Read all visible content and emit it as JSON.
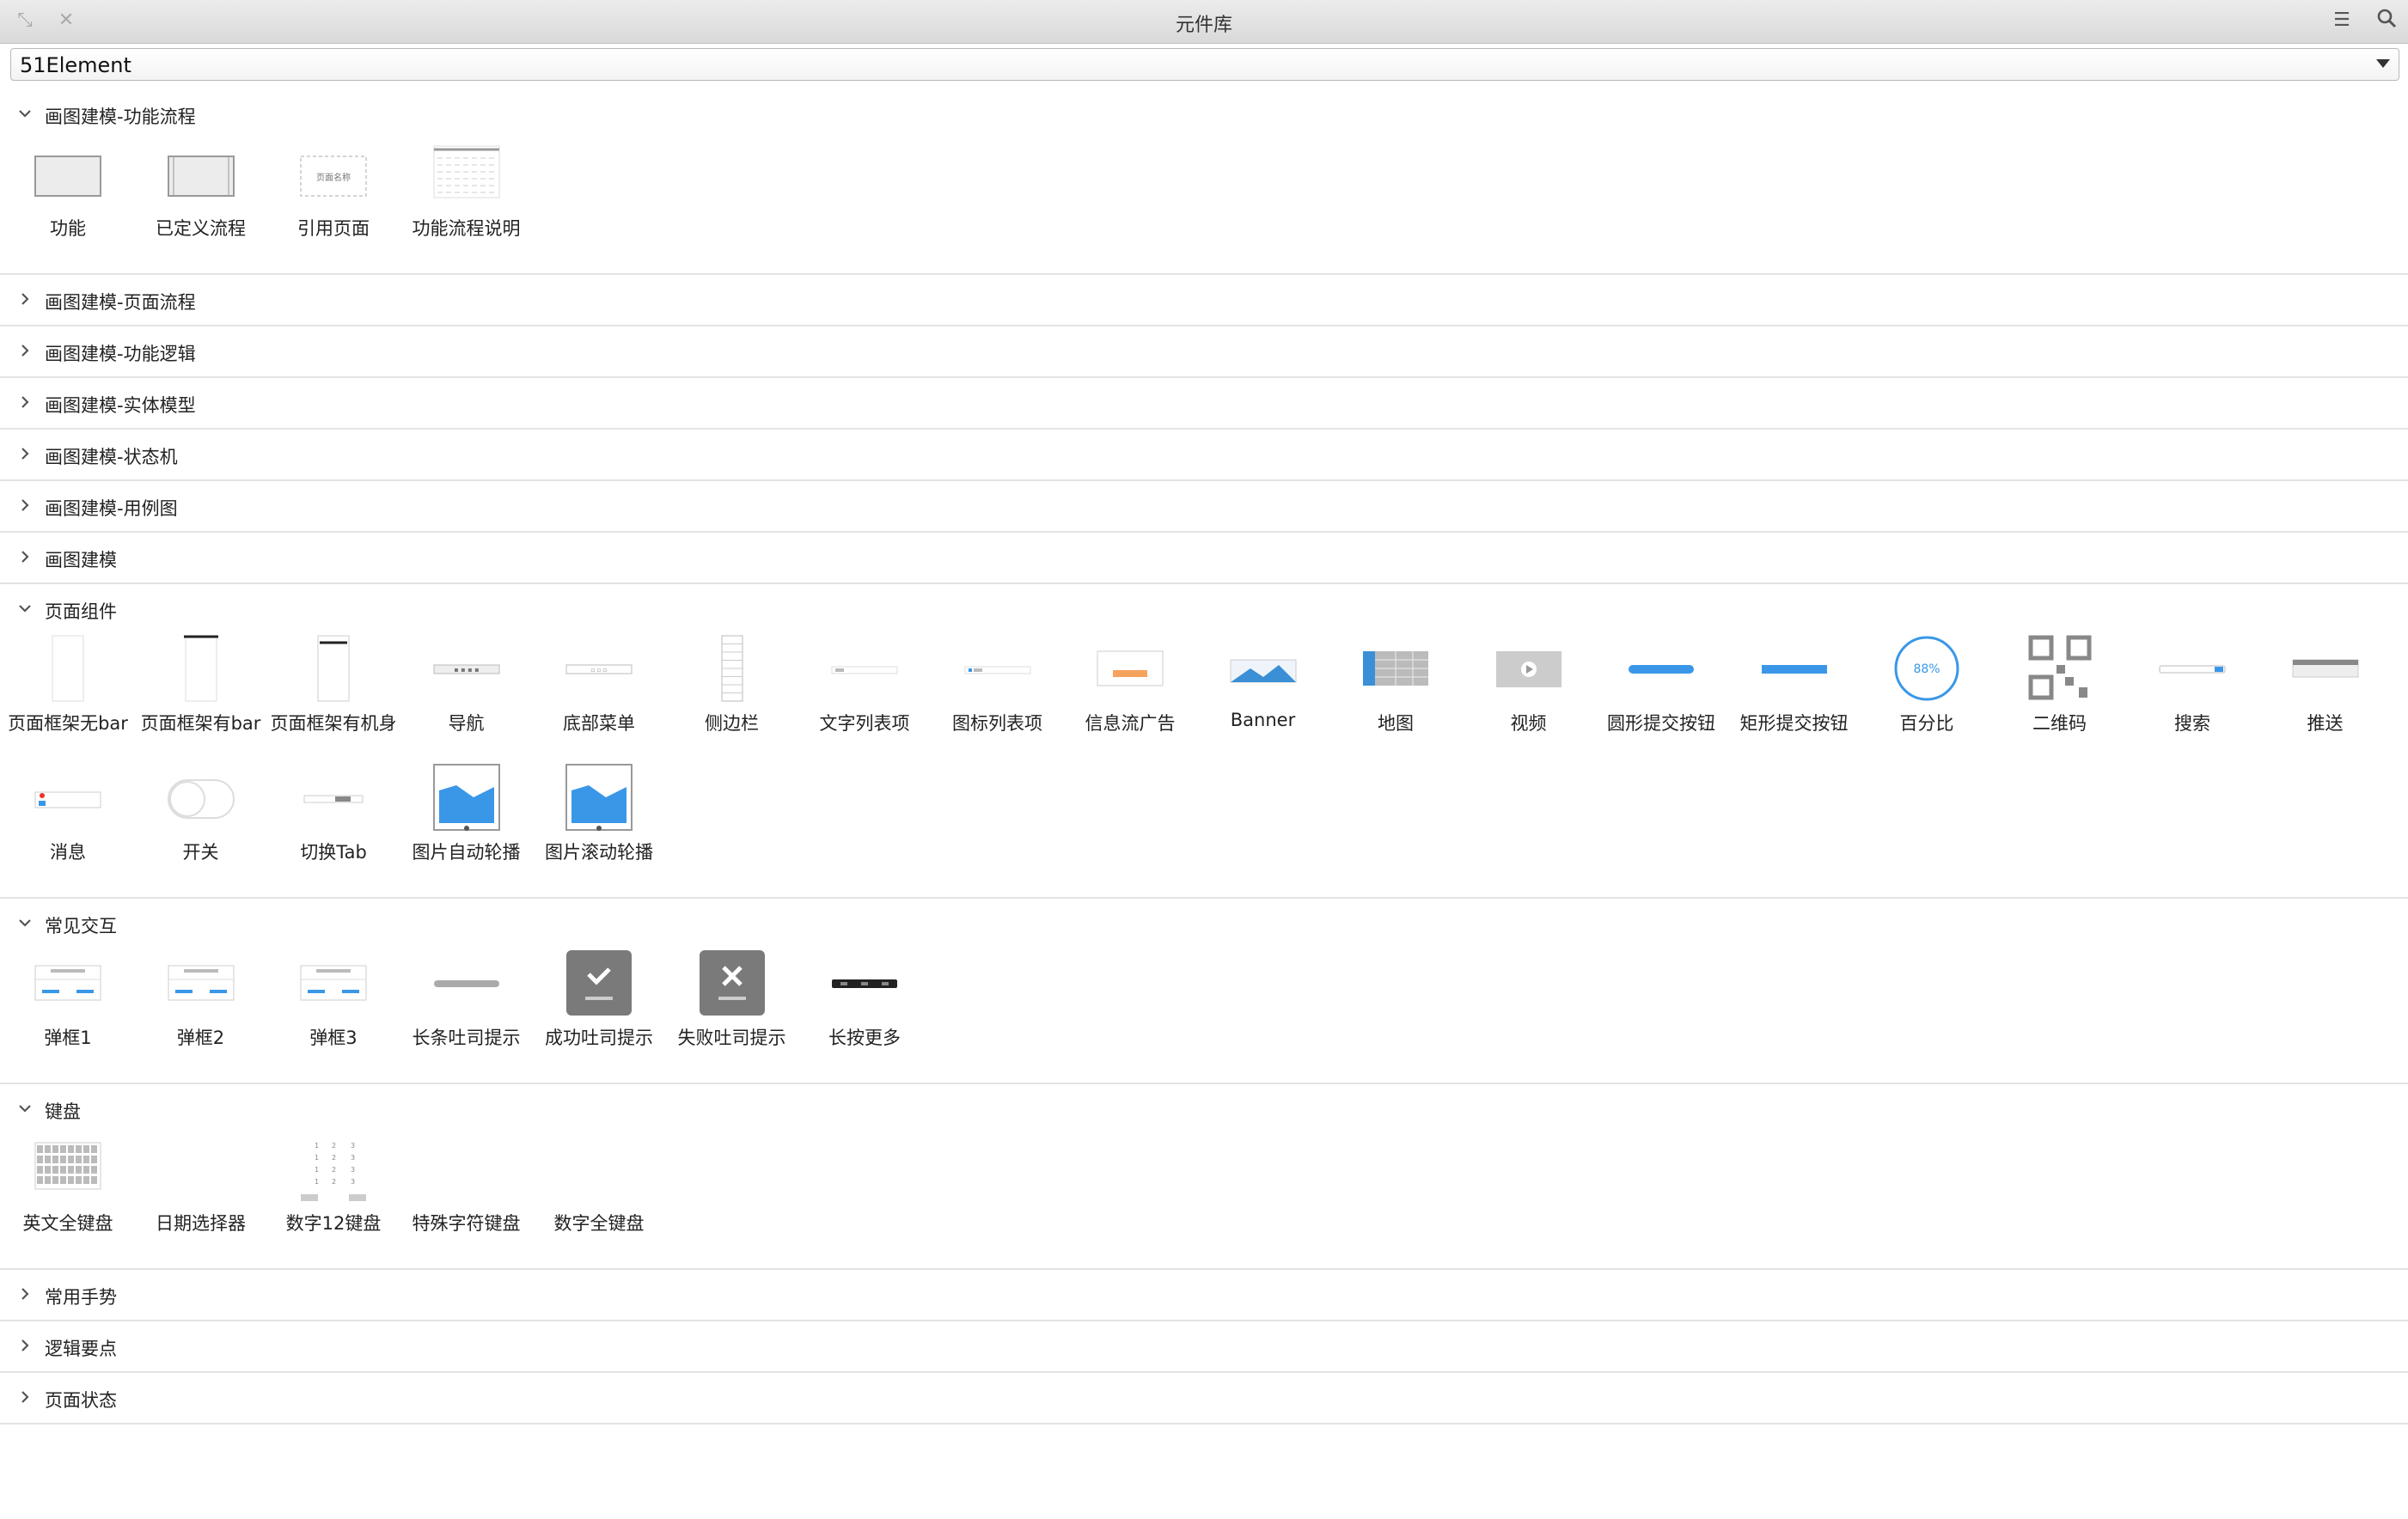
{
  "window": {
    "title": "元件库"
  },
  "library_select": {
    "value": "51Element"
  },
  "sections": [
    {
      "title": "画图建模-功能流程",
      "expanded": true,
      "items": [
        {
          "label": "功能",
          "icon": "box-icon"
        },
        {
          "label": "已定义流程",
          "icon": "defined-flow-icon"
        },
        {
          "label": "引用页面",
          "icon": "ref-page-icon",
          "text": "页面名称"
        },
        {
          "label": "功能流程说明",
          "icon": "flow-doc-icon"
        }
      ]
    },
    {
      "title": "画图建模-页面流程",
      "expanded": false,
      "items": []
    },
    {
      "title": "画图建模-功能逻辑",
      "expanded": false,
      "items": []
    },
    {
      "title": "画图建模-实体模型",
      "expanded": false,
      "items": []
    },
    {
      "title": "画图建模-状态机",
      "expanded": false,
      "items": []
    },
    {
      "title": "画图建模-用例图",
      "expanded": false,
      "items": []
    },
    {
      "title": "画图建模",
      "expanded": false,
      "items": []
    },
    {
      "title": "页面组件",
      "expanded": true,
      "items": [
        {
          "label": "页面框架无bar",
          "icon": "frame-icon"
        },
        {
          "label": "页面框架有bar",
          "icon": "frame-bar-icon"
        },
        {
          "label": "页面框架有机身",
          "icon": "frame-body-icon"
        },
        {
          "label": "导航",
          "icon": "nav-icon"
        },
        {
          "label": "底部菜单",
          "icon": "bottom-menu-icon"
        },
        {
          "label": "侧边栏",
          "icon": "sidebar-icon"
        },
        {
          "label": "文字列表项",
          "icon": "text-list-icon"
        },
        {
          "label": "图标列表项",
          "icon": "icon-list-icon"
        },
        {
          "label": "信息流广告",
          "icon": "feed-ad-icon"
        },
        {
          "label": "Banner",
          "icon": "banner-icon"
        },
        {
          "label": "地图",
          "icon": "map-icon"
        },
        {
          "label": "视频",
          "icon": "video-icon"
        },
        {
          "label": "圆形提交按钮",
          "icon": "round-submit-icon"
        },
        {
          "label": "矩形提交按钮",
          "icon": "rect-submit-icon"
        },
        {
          "label": "百分比",
          "icon": "percent-icon",
          "text": "88%"
        },
        {
          "label": "二维码",
          "icon": "qrcode-icon"
        },
        {
          "label": "搜索",
          "icon": "search-bar-icon"
        },
        {
          "label": "推送",
          "icon": "push-icon"
        },
        {
          "label": "消息",
          "icon": "message-icon"
        },
        {
          "label": "开关",
          "icon": "toggle-icon"
        },
        {
          "label": "切换Tab",
          "icon": "tab-switch-icon"
        },
        {
          "label": "图片自动轮播",
          "icon": "image-carousel-icon"
        },
        {
          "label": "图片滚动轮播",
          "icon": "image-scroll-icon"
        }
      ]
    },
    {
      "title": "常见交互",
      "expanded": true,
      "items": [
        {
          "label": "弹框1",
          "icon": "dialog-icon"
        },
        {
          "label": "弹框2",
          "icon": "dialog-icon"
        },
        {
          "label": "弹框3",
          "icon": "dialog-icon"
        },
        {
          "label": "长条吐司提示",
          "icon": "toast-bar-icon"
        },
        {
          "label": "成功吐司提示",
          "icon": "success-toast-icon"
        },
        {
          "label": "失败吐司提示",
          "icon": "fail-toast-icon"
        },
        {
          "label": "长按更多",
          "icon": "long-press-icon"
        }
      ]
    },
    {
      "title": "键盘",
      "expanded": true,
      "items": [
        {
          "label": "英文全键盘",
          "icon": "keyboard-icon"
        },
        {
          "label": "日期选择器",
          "icon": "date-picker-icon"
        },
        {
          "label": "数字12键盘",
          "icon": "numpad-icon"
        },
        {
          "label": "特殊字符键盘",
          "icon": "special-keyboard-icon"
        },
        {
          "label": "数字全键盘",
          "icon": "number-keyboard-icon"
        }
      ]
    },
    {
      "title": "常用手势",
      "expanded": false,
      "items": []
    },
    {
      "title": "逻辑要点",
      "expanded": false,
      "items": []
    },
    {
      "title": "页面状态",
      "expanded": false,
      "items": []
    }
  ],
  "colors": {
    "accent": "#3a97e8",
    "toast": "#7a7a7a",
    "map": "#3a8fd6"
  }
}
